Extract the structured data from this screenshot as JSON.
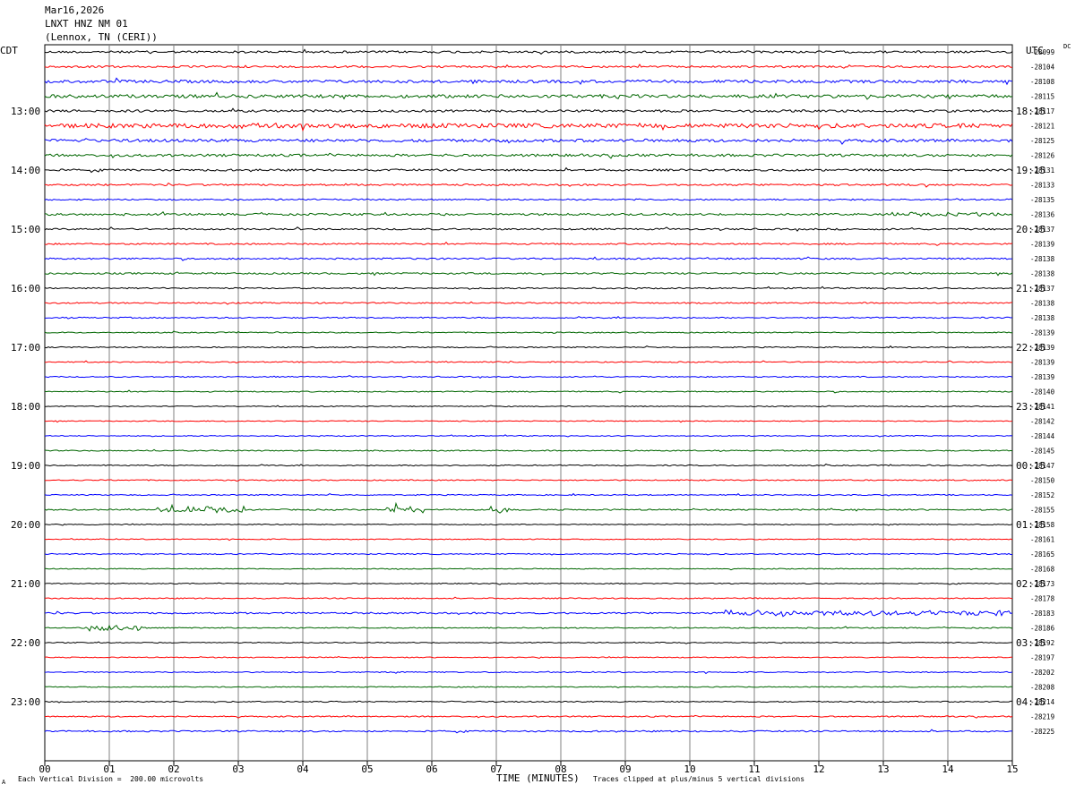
{
  "header": {
    "date": "Mar16,2026",
    "station": "LNXT HNZ NM 01",
    "location": "(Lennox, TN (CERI))"
  },
  "timezones": {
    "left": "CDT",
    "right": "UTC",
    "dc": "DC"
  },
  "footer": {
    "scale": "Each Vertical Division =  200.00 microvolts",
    "x_label": "TIME (MINUTES)",
    "clip_note": "Traces clipped at plus/minus 5 vertical divisions",
    "corner_mark": "A"
  },
  "colors": {
    "trace_cycle": [
      "#000000",
      "#ff0000",
      "#0000ff",
      "#006600"
    ],
    "grid": "#808080"
  },
  "chart_data": {
    "type": "line",
    "title": "",
    "xlabel": "TIME (MINUTES)",
    "x_ticks": [
      "00",
      "01",
      "02",
      "03",
      "04",
      "05",
      "06",
      "07",
      "08",
      "09",
      "10",
      "11",
      "12",
      "13",
      "14",
      "15"
    ],
    "xlim": [
      0,
      15
    ],
    "trace_minutes": 15,
    "grid": true,
    "left_hour_labels": [
      "13:00",
      "14:00",
      "15:00",
      "16:00",
      "17:00",
      "18:00",
      "19:00",
      "20:00",
      "21:00",
      "22:00",
      "23:00"
    ],
    "right_hour_labels": [
      "18:15",
      "19:15",
      "20:15",
      "21:15",
      "22:15",
      "23:15",
      "00:15",
      "01:15",
      "02:15",
      "03:15",
      "04:15"
    ],
    "dc_offsets": [
      28099,
      28104,
      28108,
      28115,
      28117,
      28121,
      28125,
      28126,
      28131,
      28133,
      28135,
      28136,
      28137,
      28139,
      28138,
      28138,
      28137,
      28138,
      28138,
      28139,
      28139,
      28139,
      28139,
      28140,
      28141,
      28142,
      28144,
      28145,
      28147,
      28150,
      28152,
      28155,
      28158,
      28161,
      28165,
      28168,
      28173,
      28178,
      28183,
      28186,
      28192,
      28197,
      28202,
      28208,
      28214,
      28219,
      28225
    ],
    "dc_labels": [
      "-28099",
      "-28104",
      "-28108",
      "-28115",
      "-28117",
      "-28121",
      "-28125",
      "-28126",
      "-28131",
      "-28133",
      "-28135",
      "-28136",
      "-28137",
      "-28139",
      "-28138",
      "-28138",
      "-28137",
      "-28138",
      "-28138",
      "-28139",
      "-28139",
      "-28139",
      "-28139",
      "-28140",
      "-28141",
      "-28142",
      "-28144",
      "-28145",
      "-28147",
      "-28150",
      "-28152",
      "-28155",
      "-28158",
      "-28161",
      "-28165",
      "-28168",
      "-28173",
      "-28178",
      "-28183",
      "-28186",
      "-28192",
      "-28197",
      "-28202",
      "-28208",
      "-28214",
      "-28219",
      "-28225"
    ],
    "trace_amplitudes": [
      1.2,
      1.1,
      1.6,
      1.8,
      1.3,
      2.4,
      1.6,
      1.4,
      1.1,
      1.0,
      0.8,
      1.1,
      0.9,
      0.8,
      0.9,
      0.9,
      0.7,
      0.7,
      0.7,
      0.6,
      0.6,
      0.6,
      0.6,
      0.6,
      0.5,
      0.5,
      0.5,
      0.6,
      0.6,
      0.6,
      0.6,
      0.7,
      0.5,
      0.5,
      0.6,
      0.5,
      0.5,
      0.6,
      0.9,
      0.6,
      0.5,
      0.5,
      0.6,
      0.5,
      0.6,
      0.7,
      0.8
    ],
    "events": [
      {
        "trace": 31,
        "start_min": 1.7,
        "end_min": 3.1,
        "amp": 4
      },
      {
        "trace": 31,
        "start_min": 5.3,
        "end_min": 5.9,
        "amp": 4
      },
      {
        "trace": 31,
        "start_min": 6.9,
        "end_min": 7.2,
        "amp": 4
      },
      {
        "trace": 38,
        "start_min": 10.5,
        "end_min": 15,
        "amp": 3.5
      },
      {
        "trace": 39,
        "start_min": 0.6,
        "end_min": 1.5,
        "amp": 4
      },
      {
        "trace": 5,
        "start_min": 2.6,
        "end_min": 3.8,
        "amp": 3.5
      },
      {
        "trace": 1,
        "start_min": 12.2,
        "end_min": 12.5,
        "amp": 2.5
      },
      {
        "trace": 11,
        "start_min": 13.1,
        "end_min": 14.8,
        "amp": 2.5
      }
    ]
  }
}
